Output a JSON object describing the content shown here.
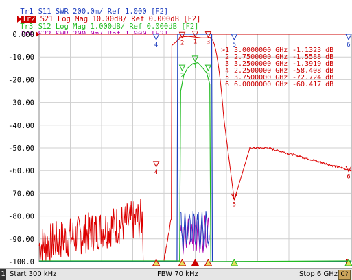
{
  "traces_header": [
    {
      "tag": "Tr1",
      "param": "S11",
      "fmt": "SWR 200.0m/ Ref 1.000 [F2]",
      "color": "#1f3fbf",
      "active": false
    },
    {
      "tag": "Tr2",
      "param": "S21",
      "fmt": "Log Mag 10.00dB/ Ref 0.000dB [F2]",
      "color": "#cc0000",
      "active": true
    },
    {
      "tag": "Tr3",
      "param": "S12",
      "fmt": "Log Mag 1.000dB/ Ref 0.000dB [F2]",
      "color": "#22bb22",
      "active": false
    },
    {
      "tag": "Tr4",
      "param": "S22",
      "fmt": "SWR 200.0m/ Ref 1.000 [F2]",
      "color": "#b000b0",
      "active": false
    }
  ],
  "y_axis": {
    "labels": [
      "0.000",
      "-10.00",
      "-20.00",
      "-30.00",
      "-40.00",
      "-50.00",
      "-60.00",
      "-70.00",
      "-80.00",
      "-90.00",
      "-100.0"
    ]
  },
  "marker_table": [
    {
      "id": ">1",
      "freq": "3.0000000 GHz",
      "value": "-1.1323 dB"
    },
    {
      "id": "2",
      "freq": "2.7500000 GHz",
      "value": "-1.5588 dB"
    },
    {
      "id": "3",
      "freq": "3.2500000 GHz",
      "value": "-1.3919 dB"
    },
    {
      "id": "4",
      "freq": "2.2500000 GHz",
      "value": "-58.408 dB"
    },
    {
      "id": "5",
      "freq": "3.7500000 GHz",
      "value": "-72.724 dB"
    },
    {
      "id": "6",
      "freq": "6.0000000 GHz",
      "value": "-60.417 dB"
    }
  ],
  "status_bar": {
    "channel": "1",
    "start": "Start 300 kHz",
    "ifbw": "IFBW 70 kHz",
    "stop": "Stop 6 GHz",
    "button": "C?"
  },
  "colors": {
    "s11": "#1f3fbf",
    "s21": "#cc0000",
    "s12": "#22bb22",
    "s22": "#b000b0",
    "grid": "#c8c8c8"
  }
}
